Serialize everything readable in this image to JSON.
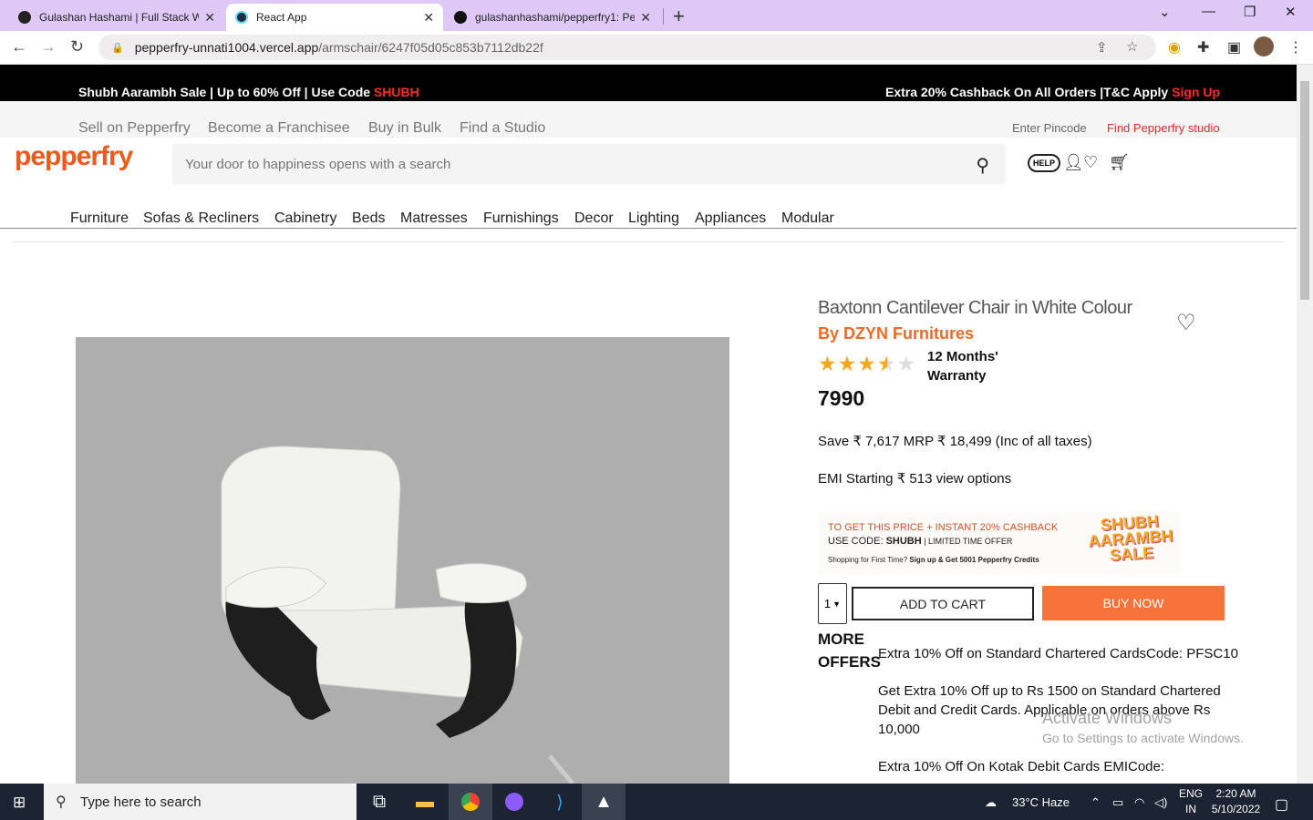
{
  "browser": {
    "tabs": [
      {
        "title": "Gulashan Hashami | Full Stack We",
        "close": "✕"
      },
      {
        "title": "React App",
        "close": "✕"
      },
      {
        "title": "gulashanhashami/pepperfry1: Pe",
        "close": "✕"
      }
    ],
    "new_tab": "+",
    "url_domain": "pepperfry-unnati1004.vercel.app",
    "url_path": "/armschair/6247f05d05c853b7112db22f"
  },
  "promo": {
    "left_text": "Shubh Aarambh Sale | Up to 60% Off | Use Code ",
    "left_code": "SHUBH",
    "right_text": "Extra 20% Cashback On All Orders |T&C Apply ",
    "right_link": "Sign Up"
  },
  "subnav": {
    "links": [
      "Sell on Pepperfry",
      "Become a Franchisee",
      "Buy in Bulk",
      "Find a Studio"
    ],
    "pincode": "Enter Pincode",
    "studio": "Find Pepperfry studio"
  },
  "header": {
    "logo": "pepperfry",
    "search_placeholder": "Your door to happiness opens with a search",
    "help": "HELP"
  },
  "categories": [
    "Furniture",
    "Sofas & Recliners",
    "Cabinetry",
    "Beds",
    "Matresses",
    "Furnishings",
    "Decor",
    "Lighting",
    "Appliances",
    "Modular"
  ],
  "product": {
    "title": "Baxtonn Cantilever Chair in White Colour",
    "brand": "By DZYN Furnitures",
    "rating": 3.5,
    "warranty": "12 Months' Warranty",
    "price": "7990",
    "save_line": "Save ₹ 7,617 MRP ₹ 18,499 (Inc of all taxes)",
    "emi_line": "EMI Starting ₹ 513 view options",
    "quantity": "1",
    "add_to_cart": "ADD TO CART",
    "buy_now": "BUY NOW"
  },
  "banner": {
    "line1": "TO GET THIS PRICE + INSTANT 20% CASHBACK",
    "line2_prefix": "USE CODE: ",
    "line2_code": "SHUBH",
    "line2_suffix": " | LIMITED TIME OFFER",
    "line3_prefix": "Shopping for First Time? ",
    "line3_bold": "Sign up & Get 5001 Pepperfry Credits",
    "sale_logo": "SHUBH AARAMBH SALE"
  },
  "offers": {
    "heading": "MORE OFFERS",
    "items": [
      "Extra 10% Off on Standard Chartered CardsCode: PFSC10",
      "Get Extra 10% Off up to Rs 1500 on Standard Chartered Debit and Credit Cards. Applicable on orders above Rs 10,000",
      "Extra 10% Off On Kotak Debit Cards EMICode:"
    ]
  },
  "watermark": {
    "line1": "Activate Windows",
    "line2": "Go to Settings to activate Windows."
  },
  "taskbar": {
    "search_placeholder": "Type here to search",
    "weather": "33°C  Haze",
    "lang1": "ENG",
    "lang2": "IN",
    "time": "2:20 AM",
    "date": "5/10/2022"
  }
}
